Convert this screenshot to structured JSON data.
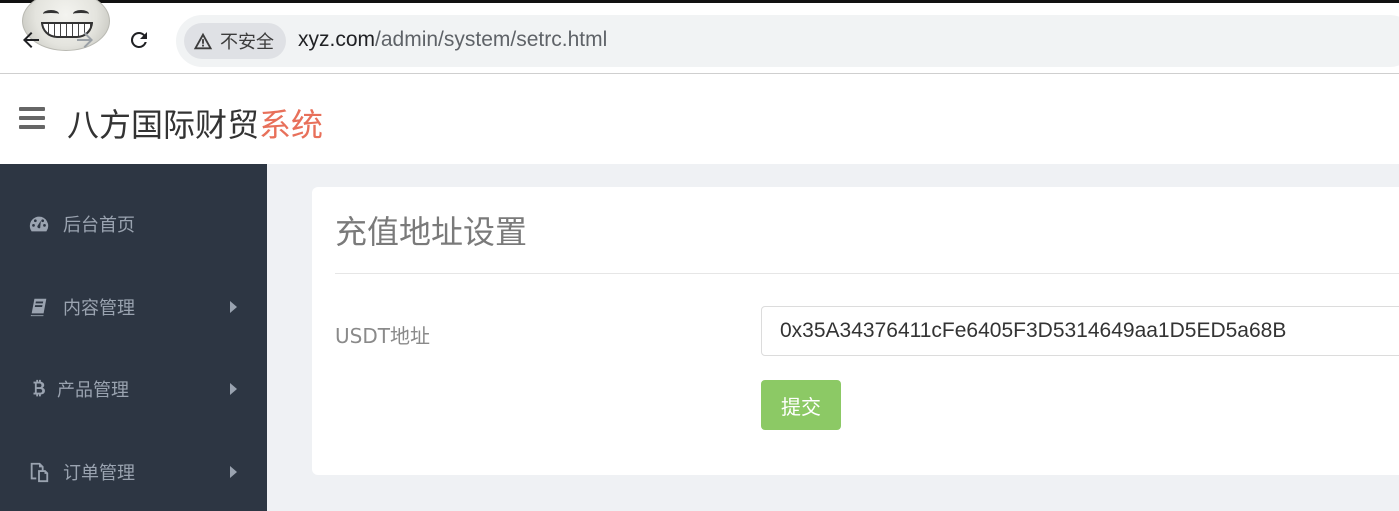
{
  "browser": {
    "security_label": "不安全",
    "url_host": "xyz.com",
    "url_path": "/admin/system/setrc.html"
  },
  "header": {
    "brand_main": "八方国际财贸",
    "brand_accent": "系统",
    "accent_color": "#e8705a"
  },
  "sidebar": {
    "items": [
      {
        "label": "后台首页",
        "icon": "dashboard-icon",
        "has_submenu": false
      },
      {
        "label": "内容管理",
        "icon": "book-icon",
        "has_submenu": true
      },
      {
        "label": "产品管理",
        "icon": "bitcoin-icon",
        "has_submenu": true
      },
      {
        "label": "订单管理",
        "icon": "copy-icon",
        "has_submenu": true
      }
    ]
  },
  "main": {
    "title": "充值地址设置",
    "form": {
      "usdt_label": "USDT地址",
      "usdt_value": "0x35A34376411cFe6405F3D5314649aa1D5ED5a68B",
      "submit_label": "提交",
      "submit_color": "#8cc965"
    }
  }
}
